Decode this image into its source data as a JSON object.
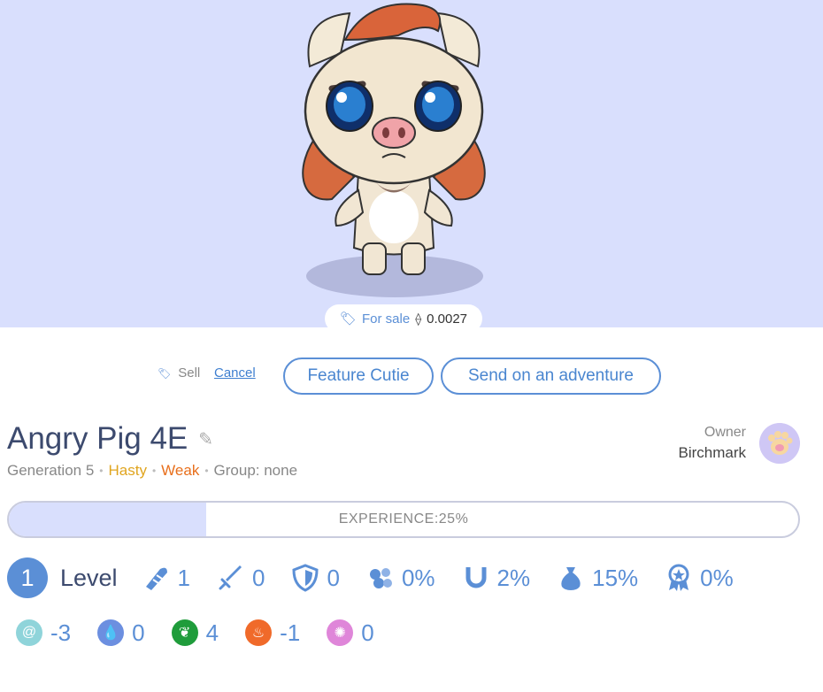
{
  "sale": {
    "label": "For sale",
    "currency_symbol": "⟠",
    "price": "0.0027"
  },
  "actions": {
    "sell_label": "Sell",
    "cancel_label": "Cancel",
    "feature_label": "Feature Cutie",
    "adventure_label": "Send on an adventure"
  },
  "cutie": {
    "name": "Angry Pig 4E",
    "generation": "Generation 5",
    "trait_speed": "Hasty",
    "trait_strength": "Weak",
    "group": "Group: none"
  },
  "owner": {
    "label": "Owner",
    "name": "Birchmark"
  },
  "experience": {
    "label": "EXPERIENCE:25%",
    "fraction": 0.25
  },
  "level": {
    "value": "1",
    "label": "Level"
  },
  "stats": {
    "attack": "1",
    "sword": "0",
    "defense": "0",
    "pet_luck": "0%",
    "horseshoe": "2%",
    "money": "15%",
    "badge": "0%"
  },
  "elements": {
    "air": "-3",
    "water": "0",
    "nature": "4",
    "fire": "-1",
    "magic": "0"
  },
  "colors": {
    "hero_bg": "#d9dffd",
    "accent": "#5b8fd6",
    "hasty": "#e0a51f",
    "weak": "#e86f1c",
    "air": "#8fd4da",
    "water": "#6c8fe0",
    "nature": "#1f9c3b",
    "fire": "#f06a2a",
    "magic": "#df86d9"
  }
}
